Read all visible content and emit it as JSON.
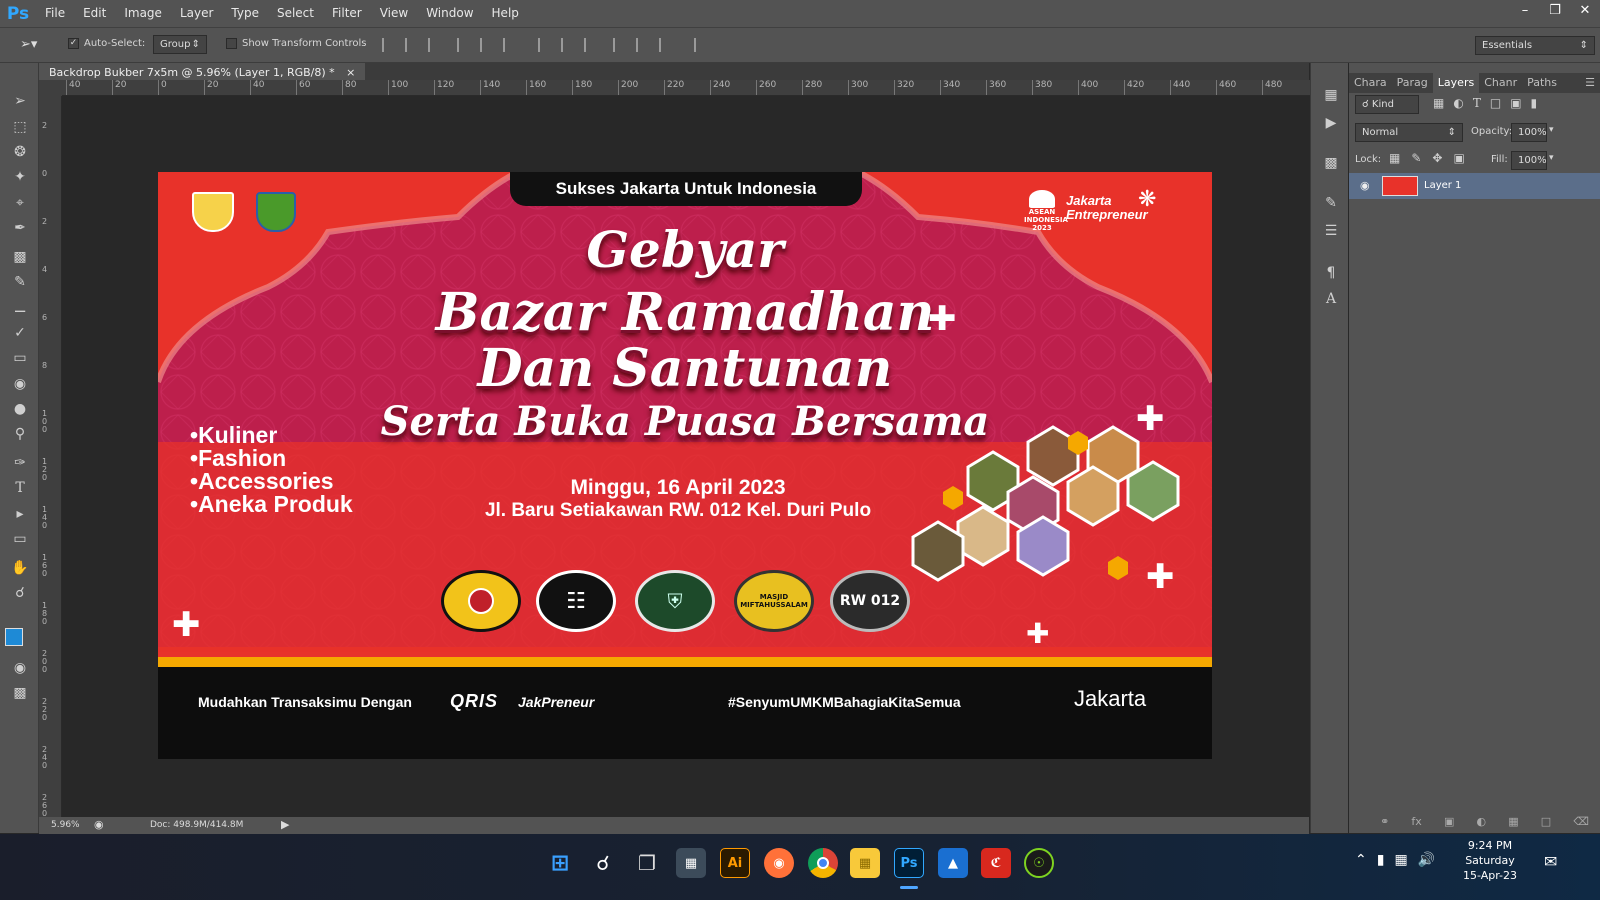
{
  "app": {
    "logo": "Ps",
    "menu": [
      "File",
      "Edit",
      "Image",
      "Layer",
      "Type",
      "Select",
      "Filter",
      "View",
      "Window",
      "Help"
    ]
  },
  "options": {
    "auto_select_label": "Auto-Select:",
    "auto_select_mode": "Group",
    "transform_label": "Show Transform Controls",
    "workspace": "Essentials"
  },
  "document": {
    "tab_title": "Backdrop Bukber 7x5m @ 5.96% (Layer 1, RGB/8) *",
    "zoom": "5.96%",
    "doc_info": "Doc: 498.9M/414.8M"
  },
  "ruler_top": [
    "40",
    "20",
    "0",
    "20",
    "40",
    "60",
    "80",
    "100",
    "120",
    "140",
    "160",
    "180",
    "200",
    "220",
    "240",
    "260",
    "280",
    "300",
    "320",
    "340",
    "360",
    "380",
    "400",
    "420",
    "440",
    "460",
    "480"
  ],
  "ruler_left": [
    "2",
    "0",
    "2",
    "4",
    "6",
    "8",
    "100",
    "120",
    "140",
    "160",
    "180",
    "200",
    "220",
    "240",
    "260"
  ],
  "artwork": {
    "header": "Sukses Jakarta Untuk Indonesia",
    "asean": "ASEAN INDONESIA 2023",
    "jakarta_entrepreneur": "Jakarta Entrepreneur",
    "title1": "Gebyar",
    "title2": "Bazar Ramadhan",
    "title3": "Dan Santunan",
    "title4": "Serta Buka Puasa Bersama",
    "bullets": [
      "Kuliner",
      "Fashion",
      "Accessories",
      "Aneka Produk"
    ],
    "date": "Minggu, 16 April 2023",
    "address": "Jl. Baru Setiakawan RW. 012 Kel. Duri Pulo",
    "badge_rw": "RW 012",
    "badge_masjid": "MASJID MIFTAHUSSALAM",
    "footer_left": "Mudahkan Transaksimu Dengan",
    "qris": "QRIS",
    "jakpreneur": "JakPreneur",
    "hashtag": "#SenyumUMKMBahagiaKitaSemua",
    "jakarta_logo": "Jakarta",
    "colors": {
      "red": "#e8322a",
      "yellow": "#f5a800",
      "dark": "#111111"
    }
  },
  "panel": {
    "tabs": [
      "Chara",
      "Parag",
      "Layers",
      "Chanr",
      "Paths"
    ],
    "active_tab": "Layers",
    "kind": "Kind",
    "blend_mode": "Normal",
    "opacity_label": "Opacity:",
    "opacity": "100%",
    "lock_label": "Lock:",
    "fill_label": "Fill:",
    "fill": "100%",
    "layer_name": "Layer 1"
  },
  "clock": {
    "time": "9:24 PM",
    "day": "Saturday",
    "date": "15-Apr-23"
  }
}
